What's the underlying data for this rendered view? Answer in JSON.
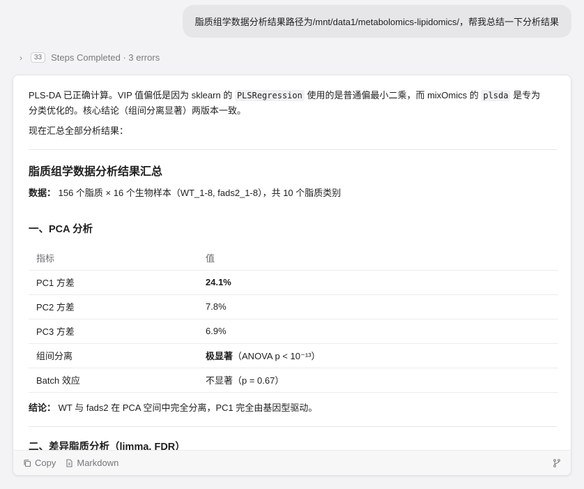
{
  "user_message": "脂质组学数据分析结果路径为/mnt/data1/metabolomics-lipidomics/，帮我总结一下分析结果",
  "steps": {
    "count": "33",
    "label": "Steps Completed · 3 errors"
  },
  "intro": {
    "p1_a": "PLS-DA 已正确计算。VIP 值偏低是因为 sklearn 的 ",
    "p1_code1": "PLSRegression",
    "p1_b": " 使用的是普通偏最小二乘，而 mixOmics 的 ",
    "p1_code2": "plsda",
    "p1_c": " 是专为",
    "p1_line2": "分类优化的。核心结论（组间分离显著）两版本一致。",
    "p2": "现在汇总全部分析结果："
  },
  "summary": {
    "title": "脂质组学数据分析结果汇总",
    "data_label": "数据：",
    "data_text": " 156 个脂质 × 16 个生物样本（WT_1-8, fads2_1-8），共 10 个脂质类别"
  },
  "pca": {
    "heading": "一、PCA 分析",
    "headers": [
      "指标",
      "值"
    ],
    "rows": [
      {
        "metric": "PC1 方差",
        "value": "24.1%"
      },
      {
        "metric": "PC2 方差",
        "value": "7.8%"
      },
      {
        "metric": "PC3 方差",
        "value": "6.9%"
      },
      {
        "metric": "组间分离",
        "value_bold": "极显著",
        "value_rest": "（ANOVA p < 10⁻¹³）"
      },
      {
        "metric": "Batch 效应",
        "value": "不显著（p = 0.67）"
      }
    ],
    "conclusion_label": "结论：",
    "conclusion_text": " WT 与 fads2 在 PCA 空间中完全分离，PC1 完全由基因型驱动。"
  },
  "section2": {
    "heading": "二、差异脂质分析（limma, FDR）"
  },
  "footer": {
    "copy": "Copy",
    "markdown": "Markdown"
  },
  "icons": {
    "copy": "copy-icon",
    "markdown": "file-icon",
    "branch": "git-branch-icon",
    "chevron": "chevron-right-icon"
  }
}
